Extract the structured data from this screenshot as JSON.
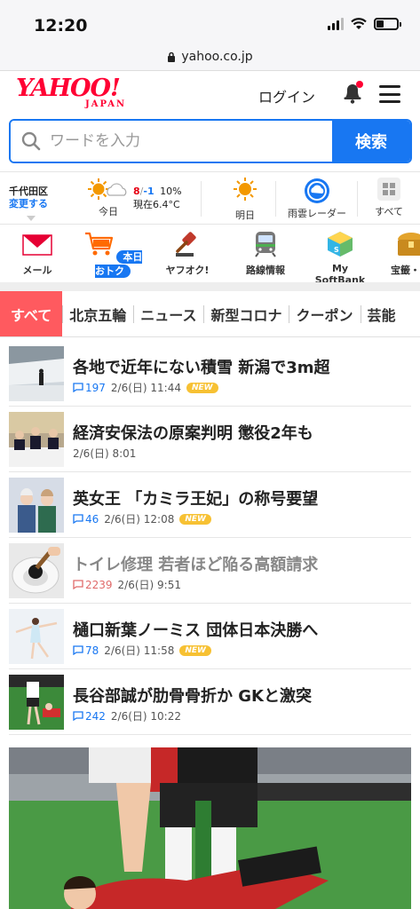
{
  "status": {
    "time": "12:20"
  },
  "browser": {
    "url": "yahoo.co.jp"
  },
  "header": {
    "logo_main": "YAHOO!",
    "logo_sub": "JAPAN",
    "login": "ログイン"
  },
  "search": {
    "placeholder": "ワードを入力",
    "button": "検索"
  },
  "weather": {
    "location": "千代田区",
    "change": "変更する",
    "today_label": "今日",
    "hi": "8",
    "lo": "-1",
    "rain": "10%",
    "current": "現在6.4°C",
    "tomorrow_label": "明日",
    "radar_label": "雨雲レーダー",
    "all_label": "すべて"
  },
  "services": [
    {
      "label": "メール"
    },
    {
      "label": "本日おトク"
    },
    {
      "label": "ヤフオク!"
    },
    {
      "label": "路線情報"
    },
    {
      "label": "My SoftBank"
    },
    {
      "label": "宝籤・"
    }
  ],
  "tabs": [
    "すべて",
    "北京五輪",
    "ニュース",
    "新型コロナ",
    "クーポン",
    "芸能"
  ],
  "news": [
    {
      "title": "各地で近年にない積雪 新潟で3m超",
      "comments": "197",
      "date": "2/6(日) 11:44",
      "new": "NEW"
    },
    {
      "title": "経済安保法の原案判明 懲役2年も",
      "comments": "",
      "date": "2/6(日) 8:01",
      "new": ""
    },
    {
      "title": "英女王 「カミラ王妃」の称号要望",
      "comments": "46",
      "date": "2/6(日) 12:08",
      "new": "NEW"
    },
    {
      "title": "トイレ修理 若者ほど陥る高額請求",
      "comments": "2239",
      "date": "2/6(日) 9:51",
      "new": ""
    },
    {
      "title": "樋口新葉ノーミス 団体日本決勝へ",
      "comments": "78",
      "date": "2/6(日) 11:58",
      "new": "NEW"
    },
    {
      "title": "長谷部誠が肋骨骨折か GKと激突",
      "comments": "242",
      "date": "2/6(日) 10:22",
      "new": ""
    }
  ],
  "colors": {
    "accent": "#1877f2",
    "brand": "#ff0033",
    "tab_active": "#ff5a5f",
    "new_badge": "#f7c133"
  }
}
